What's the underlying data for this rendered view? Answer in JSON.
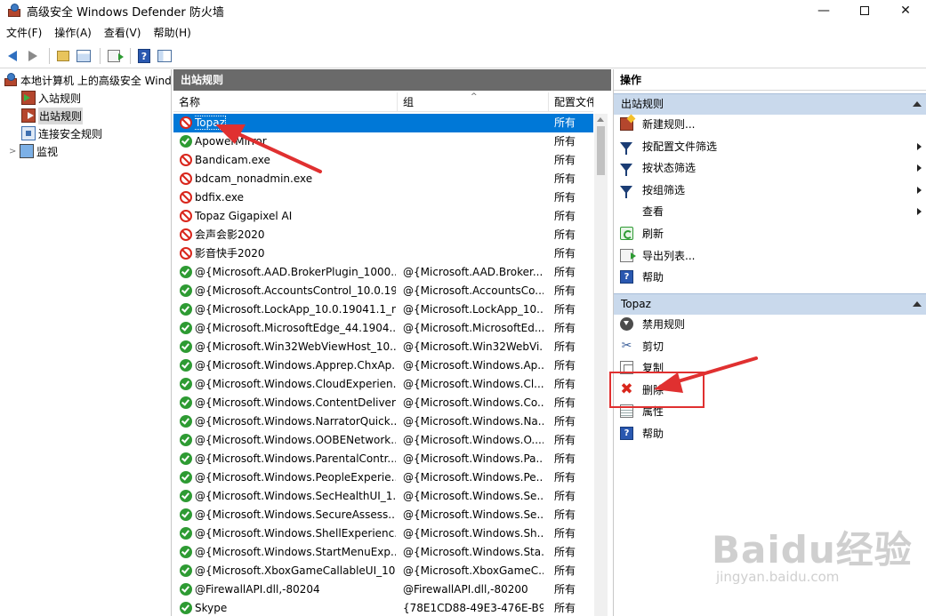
{
  "window": {
    "title": "高级安全 Windows Defender 防火墙",
    "minimize": "—",
    "close": "✕"
  },
  "menu": [
    "文件(F)",
    "操作(A)",
    "查看(V)",
    "帮助(H)"
  ],
  "tree": {
    "root": "本地计算机 上的高级安全 Windows Defender 防火墙",
    "inbound": "入站规则",
    "outbound": "出站规则",
    "connection": "连接安全规则",
    "monitor": "监视"
  },
  "list": {
    "header": "出站规则",
    "columns": {
      "name": "名称",
      "group": "组",
      "profile": "配置文件"
    },
    "rows": [
      {
        "name": "Topaz",
        "group": "",
        "profile": "所有",
        "status": "block",
        "selected": true
      },
      {
        "name": "ApowerMirror",
        "group": "",
        "profile": "所有",
        "status": "allow"
      },
      {
        "name": "Bandicam.exe",
        "group": "",
        "profile": "所有",
        "status": "block"
      },
      {
        "name": "bdcam_nonadmin.exe",
        "group": "",
        "profile": "所有",
        "status": "block"
      },
      {
        "name": "bdfix.exe",
        "group": "",
        "profile": "所有",
        "status": "block"
      },
      {
        "name": "Topaz Gigapixel AI",
        "group": "",
        "profile": "所有",
        "status": "block"
      },
      {
        "name": "会声会影2020",
        "group": "",
        "profile": "所有",
        "status": "block"
      },
      {
        "name": "影音快手2020",
        "group": "",
        "profile": "所有",
        "status": "block"
      },
      {
        "name": "@{Microsoft.AAD.BrokerPlugin_1000....",
        "group": "@{Microsoft.AAD.Broker....",
        "profile": "所有",
        "status": "allow"
      },
      {
        "name": "@{Microsoft.AccountsControl_10.0.19....",
        "group": "@{Microsoft.AccountsCo....",
        "profile": "所有",
        "status": "allow"
      },
      {
        "name": "@{Microsoft.LockApp_10.0.19041.1_n....",
        "group": "@{Microsoft.LockApp_10....",
        "profile": "所有",
        "status": "allow"
      },
      {
        "name": "@{Microsoft.MicrosoftEdge_44.1904....",
        "group": "@{Microsoft.MicrosoftEd....",
        "profile": "所有",
        "status": "allow"
      },
      {
        "name": "@{Microsoft.Win32WebViewHost_10....",
        "group": "@{Microsoft.Win32WebVi....",
        "profile": "所有",
        "status": "allow"
      },
      {
        "name": "@{Microsoft.Windows.Apprep.ChxAp....",
        "group": "@{Microsoft.Windows.Ap....",
        "profile": "所有",
        "status": "allow"
      },
      {
        "name": "@{Microsoft.Windows.CloudExperien....",
        "group": "@{Microsoft.Windows.Cl....",
        "profile": "所有",
        "status": "allow"
      },
      {
        "name": "@{Microsoft.Windows.ContentDeliver....",
        "group": "@{Microsoft.Windows.Co....",
        "profile": "所有",
        "status": "allow"
      },
      {
        "name": "@{Microsoft.Windows.NarratorQuick....",
        "group": "@{Microsoft.Windows.Na....",
        "profile": "所有",
        "status": "allow"
      },
      {
        "name": "@{Microsoft.Windows.OOBENetwork....",
        "group": "@{Microsoft.Windows.O....",
        "profile": "所有",
        "status": "allow"
      },
      {
        "name": "@{Microsoft.Windows.ParentalContr....",
        "group": "@{Microsoft.Windows.Pa....",
        "profile": "所有",
        "status": "allow"
      },
      {
        "name": "@{Microsoft.Windows.PeopleExperie....",
        "group": "@{Microsoft.Windows.Pe....",
        "profile": "所有",
        "status": "allow"
      },
      {
        "name": "@{Microsoft.Windows.SecHealthUI_1....",
        "group": "@{Microsoft.Windows.Se....",
        "profile": "所有",
        "status": "allow"
      },
      {
        "name": "@{Microsoft.Windows.SecureAssess....",
        "group": "@{Microsoft.Windows.Se....",
        "profile": "所有",
        "status": "allow"
      },
      {
        "name": "@{Microsoft.Windows.ShellExperienc....",
        "group": "@{Microsoft.Windows.Sh....",
        "profile": "所有",
        "status": "allow"
      },
      {
        "name": "@{Microsoft.Windows.StartMenuExp....",
        "group": "@{Microsoft.Windows.Sta....",
        "profile": "所有",
        "status": "allow"
      },
      {
        "name": "@{Microsoft.XboxGameCallableUI_10....",
        "group": "@{Microsoft.XboxGameC....",
        "profile": "所有",
        "status": "allow"
      },
      {
        "name": "@FirewallAPI.dll,-80204",
        "group": "@FirewallAPI.dll,-80200",
        "profile": "所有",
        "status": "allow"
      },
      {
        "name": "Skype",
        "group": "{78E1CD88-49E3-476E-B9....",
        "profile": "所有",
        "status": "allow"
      }
    ]
  },
  "actions": {
    "title": "操作",
    "section1": {
      "label": "出站规则",
      "items": [
        {
          "label": "新建规则...",
          "icon": "new-rule-icon",
          "submenu": false
        },
        {
          "label": "按配置文件筛选",
          "icon": "filter-icon",
          "submenu": true
        },
        {
          "label": "按状态筛选",
          "icon": "filter-icon",
          "submenu": true
        },
        {
          "label": "按组筛选",
          "icon": "filter-icon",
          "submenu": true
        },
        {
          "label": "查看",
          "icon": "",
          "submenu": true
        },
        {
          "label": "刷新",
          "icon": "refresh-icon",
          "submenu": false
        },
        {
          "label": "导出列表...",
          "icon": "export-icon",
          "submenu": false
        },
        {
          "label": "帮助",
          "icon": "help-icon",
          "submenu": false
        }
      ]
    },
    "section2": {
      "label": "Topaz",
      "items": [
        {
          "label": "禁用规则",
          "icon": "disable-icon"
        },
        {
          "label": "剪切",
          "icon": "cut-icon"
        },
        {
          "label": "复制",
          "icon": "copy-icon"
        },
        {
          "label": "删除",
          "icon": "delete-icon"
        },
        {
          "label": "属性",
          "icon": "properties-icon"
        },
        {
          "label": "帮助",
          "icon": "help-icon"
        }
      ]
    }
  },
  "watermark": {
    "text": "Baidu经验",
    "sub": "jingyan.baidu.com"
  },
  "colors": {
    "selection": "#0078d7",
    "allow": "#2e9b33",
    "block": "#d9261c",
    "annotation": "#e03030",
    "section": "#c9d9ec"
  }
}
